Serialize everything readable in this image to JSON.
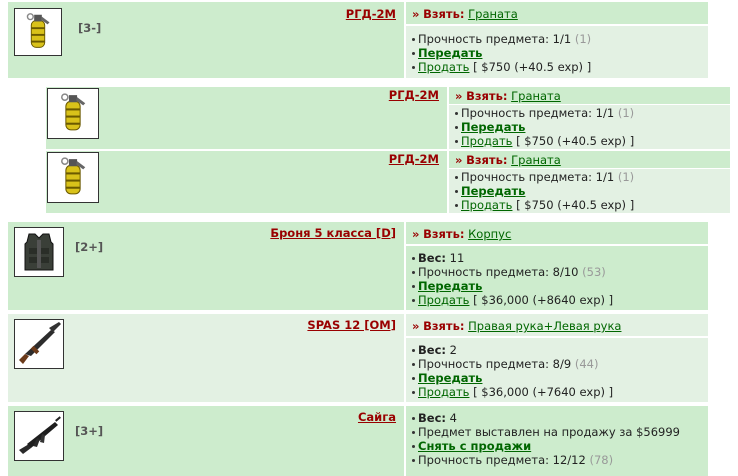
{
  "labels": {
    "arrow": "»",
    "take": "Взять:",
    "durability": "Прочность предмета:",
    "transfer": "Передать",
    "sell": "Продать",
    "weight": "Вес:",
    "unlist": "Снять с продажи"
  },
  "items": [
    {
      "name": "РГД-2М",
      "icon": "grenade-icon",
      "count": "[3-]",
      "slot": "Граната",
      "durability": "1/1",
      "durability_max": "(1)",
      "price": "[ $750 (+40.5 exp) ]"
    },
    {
      "name": "РГД-2М",
      "icon": "grenade-icon",
      "slot": "Граната",
      "durability": "1/1",
      "durability_max": "(1)",
      "price": "[ $750 (+40.5 exp) ]"
    },
    {
      "name": "РГД-2М",
      "icon": "grenade-icon",
      "slot": "Граната",
      "durability": "1/1",
      "durability_max": "(1)",
      "price": "[ $750 (+40.5 exp) ]"
    },
    {
      "name": "Броня 5 класса [D]",
      "icon": "body-armor-icon",
      "count": "[2+]",
      "slot": "Корпус",
      "weight": "11",
      "durability": "8/10",
      "durability_max": "(53)",
      "price": "[ $36,000 (+8640 exp) ]"
    },
    {
      "name": "SPAS 12 [OM]",
      "icon": "shotgun-icon",
      "slot": "Правая рука+Левая рука",
      "weight": "2",
      "durability": "8/9",
      "durability_max": "(44)",
      "price": "[ $36,000 (+7640 exp) ]"
    },
    {
      "name": "Сайга",
      "icon": "rifle-icon",
      "count": "[3+]",
      "weight": "4",
      "listed_text": "Предмет выставлен на продажу за $56999",
      "durability": "12/12",
      "durability_max": "(78)"
    }
  ]
}
